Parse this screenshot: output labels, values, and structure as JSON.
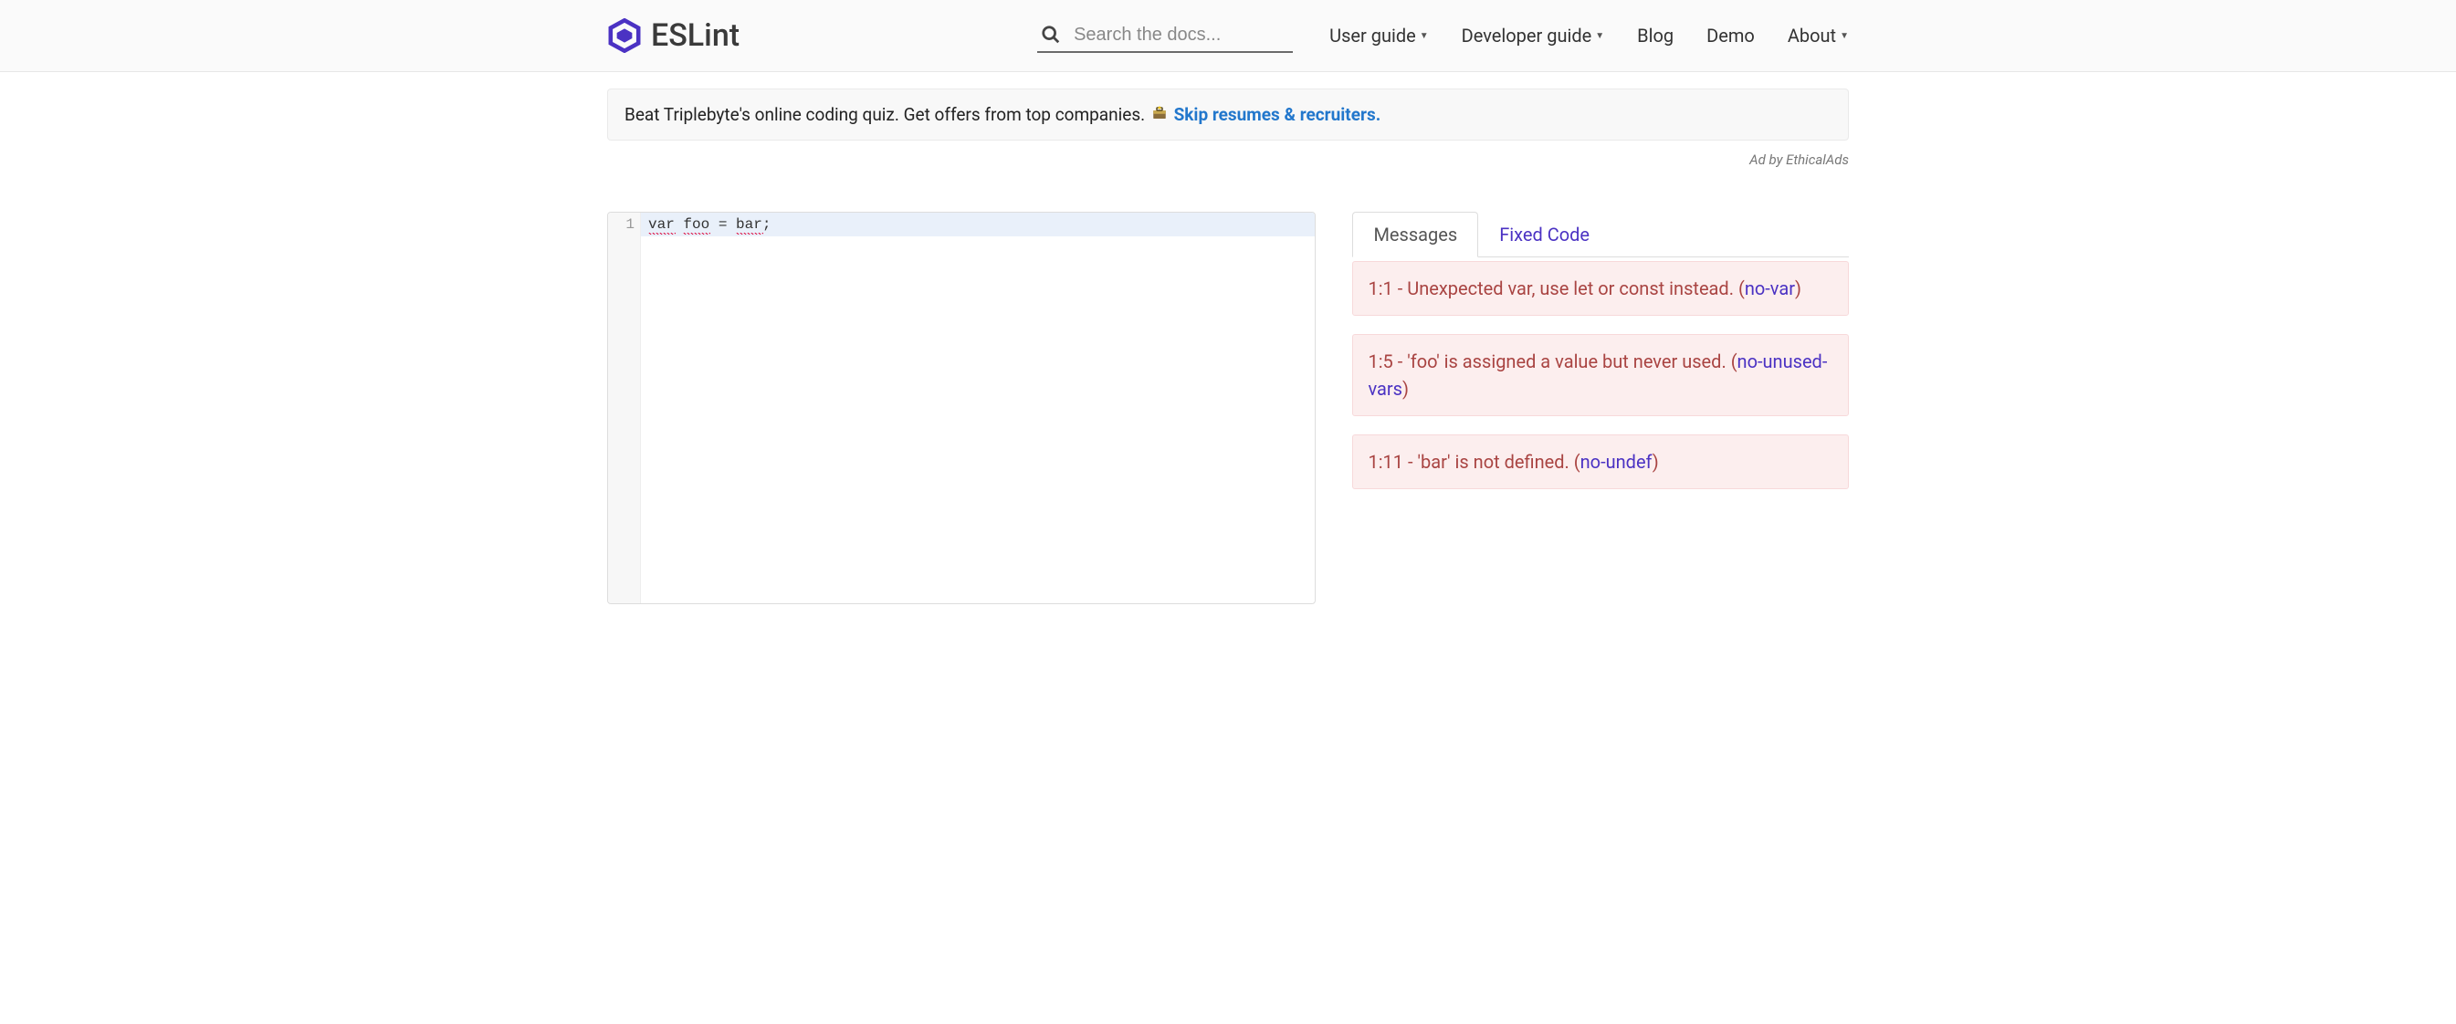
{
  "brand": {
    "name": "ESLint"
  },
  "search": {
    "placeholder": "Search the docs..."
  },
  "nav": {
    "items": [
      {
        "label": "User guide",
        "dropdown": true
      },
      {
        "label": "Developer guide",
        "dropdown": true
      },
      {
        "label": "Blog",
        "dropdown": false
      },
      {
        "label": "Demo",
        "dropdown": false
      },
      {
        "label": "About",
        "dropdown": true
      }
    ]
  },
  "ad": {
    "text": "Beat Triplebyte's online coding quiz. Get offers from top companies. ",
    "cta": "Skip resumes & recruiters.",
    "attribution": "Ad by EthicalAds"
  },
  "editor": {
    "lines": [
      {
        "n": "1",
        "text": "var foo = bar;"
      }
    ]
  },
  "tabs": {
    "messages": "Messages",
    "fixed": "Fixed Code"
  },
  "messages": [
    {
      "loc": "1:1",
      "text": "Unexpected var, use let or const instead.",
      "rule": "no-var"
    },
    {
      "loc": "1:5",
      "text": "'foo' is assigned a value but never used.",
      "rule": "no-unused-vars"
    },
    {
      "loc": "1:11",
      "text": "'bar' is not defined.",
      "rule": "no-undef"
    }
  ]
}
